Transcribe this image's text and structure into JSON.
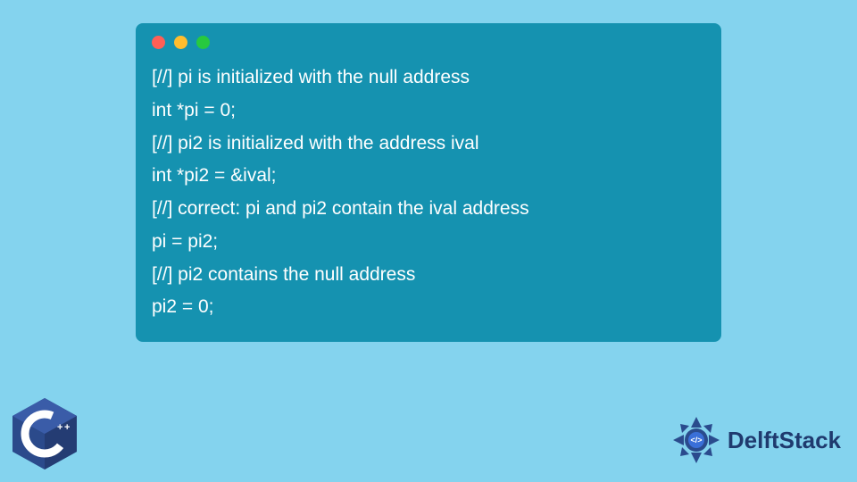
{
  "code": {
    "lines": [
      "[//] pi is initialized with the null address",
      "int *pi = 0;",
      "[//] pi2 is initialized with the address ival",
      "int *pi2 = &ival;",
      "[//] correct: pi and pi2 contain the ival address",
      "pi = pi2;",
      "[//] pi2 contains the null address",
      "pi2 = 0;"
    ]
  },
  "brand": {
    "name": "DelftStack"
  },
  "logos": {
    "cpp": "C++"
  }
}
